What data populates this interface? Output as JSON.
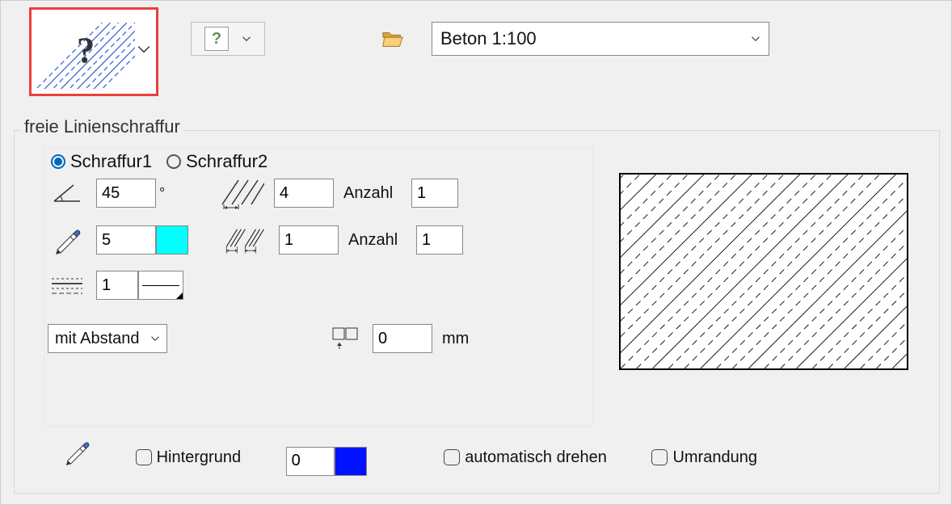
{
  "top": {
    "preset": "Beton 1:100"
  },
  "group_title": "freie Linienschraffur",
  "tabs": {
    "tab1": "Schraffur1",
    "tab2": "Schraffur2"
  },
  "angle": "45",
  "angle_unit": "°",
  "pen": "5",
  "linetype": "1",
  "count1_dist": "4",
  "count1_lbl": "Anzahl",
  "count1_val": "1",
  "count2_dist": "1",
  "count2_lbl": "Anzahl",
  "count2_val": "1",
  "abstand_option": "mit Abstand",
  "origin_dist": "0",
  "origin_unit": "mm",
  "bottom": {
    "hintergrund_lbl": "Hintergrund",
    "hintergrund_val": "0",
    "auto_lbl": "automatisch drehen",
    "umrandung_lbl": "Umrandung"
  }
}
